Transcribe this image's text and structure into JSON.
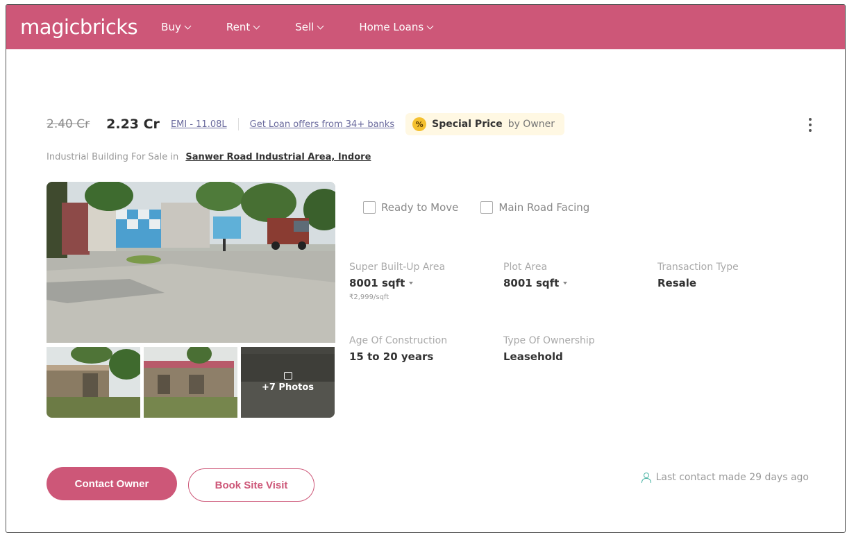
{
  "header": {
    "logo": "magicbricks",
    "nav": [
      {
        "label": "Buy"
      },
      {
        "label": "Rent"
      },
      {
        "label": "Sell"
      },
      {
        "label": "Home Loans"
      }
    ]
  },
  "listing": {
    "old_price": "2.40 Cr",
    "price": "2.23 Cr",
    "emi": "EMI - 11.08L",
    "loan_offer": "Get Loan offers from 34+ banks",
    "special_price_label": "Special Price",
    "special_price_by": "by Owner",
    "special_icon": "%",
    "subtitle_prefix": "Industrial Building For Sale in",
    "location": "Sanwer Road Industrial Area, Indore",
    "more_photos": "+7 Photos",
    "tags": [
      "Ready to Move",
      "Main Road Facing"
    ],
    "specs": {
      "super_area_label": "Super Built-Up Area",
      "super_area_value": "8001 sqft",
      "super_area_rate": "₹2,999/sqft",
      "plot_area_label": "Plot Area",
      "plot_area_value": "8001 sqft",
      "transaction_label": "Transaction Type",
      "transaction_value": "Resale",
      "age_label": "Age Of Construction",
      "age_value": "15 to 20 years",
      "ownership_label": "Type Of Ownership",
      "ownership_value": "Leasehold"
    },
    "contact_button": "Contact Owner",
    "visit_button": "Book Site Visit",
    "last_contact": "Last contact made 29 days ago"
  },
  "colors": {
    "brand": "#cd5778",
    "special_bg": "#fff8e3",
    "badge": "#f4c02e"
  }
}
